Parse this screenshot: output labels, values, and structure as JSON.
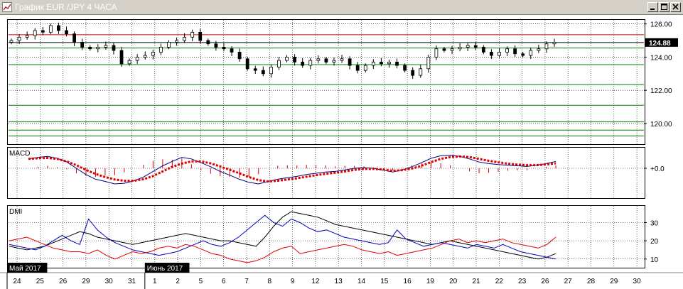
{
  "window": {
    "title": "График EUR /JPY  4 ЧАСА",
    "buttons": [
      "minimize",
      "maximize",
      "close"
    ]
  },
  "colors": {
    "background": "#ffffff",
    "grid": "#000000",
    "red_level": "#c00000",
    "green_level": "#008000",
    "price_badge_bg": "#000000",
    "price_badge_fg": "#ffffff",
    "macd_line": "#000080",
    "signal_line": "#e00000",
    "histogram": "#e00000",
    "dmi_adx": "#000000",
    "dmi_plus": "#0000c0",
    "dmi_minus": "#e00000"
  },
  "chart_data": [
    {
      "type": "candlestick",
      "panel": "price",
      "y_ticks": [
        "126.00",
        "124.00",
        "122.00",
        "120.00"
      ],
      "ylim": [
        118.8,
        126.2
      ],
      "current_price": "124.88",
      "horizontal_levels": [
        {
          "value": 125.35,
          "color": "red"
        },
        {
          "value": 124.88,
          "color": "black"
        },
        {
          "value": 124.55,
          "color": "green"
        },
        {
          "value": 123.55,
          "color": "green"
        },
        {
          "value": 122.35,
          "color": "green"
        },
        {
          "value": 121.1,
          "color": "green"
        },
        {
          "value": 120.1,
          "color": "green"
        },
        {
          "value": 119.6,
          "color": "green"
        },
        {
          "value": 119.25,
          "color": "green"
        }
      ],
      "close_series": [
        125.0,
        125.2,
        125.3,
        125.6,
        125.5,
        125.9,
        125.6,
        125.4,
        124.9,
        124.6,
        124.5,
        124.6,
        124.7,
        124.4,
        123.6,
        123.8,
        124.0,
        124.1,
        124.3,
        124.6,
        124.9,
        125.0,
        125.2,
        125.5,
        125.0,
        124.8,
        124.6,
        124.5,
        124.3,
        123.9,
        123.3,
        123.2,
        123.0,
        123.4,
        123.8,
        124.0,
        123.7,
        123.5,
        123.8,
        123.9,
        123.7,
        123.8,
        123.9,
        123.5,
        123.2,
        123.5,
        123.7,
        123.6,
        123.7,
        123.5,
        123.2,
        122.9,
        123.3,
        124.0,
        124.5,
        124.4,
        124.5,
        124.6,
        124.7,
        124.6,
        124.3,
        124.1,
        124.3,
        124.5,
        124.2,
        124.1,
        124.4,
        124.5,
        124.8,
        124.9
      ]
    },
    {
      "type": "macd",
      "panel": "MACD",
      "label": "MACD",
      "y_tick": "+0.0",
      "macd_series": [
        0.3,
        0.35,
        0.38,
        0.32,
        0.2,
        0.0,
        -0.2,
        -0.35,
        -0.42,
        -0.5,
        -0.48,
        -0.4,
        -0.28,
        -0.1,
        0.08,
        0.22,
        0.35,
        0.3,
        0.18,
        0.05,
        -0.1,
        -0.22,
        -0.35,
        -0.45,
        -0.5,
        -0.42,
        -0.35,
        -0.3,
        -0.26,
        -0.2,
        -0.16,
        -0.12,
        -0.1,
        -0.05,
        0.0,
        0.02,
        0.0,
        -0.06,
        -0.12,
        -0.05,
        0.05,
        0.18,
        0.32,
        0.4,
        0.42,
        0.38,
        0.3,
        0.2,
        0.15,
        0.12,
        0.1,
        0.08,
        0.06,
        0.1,
        0.15,
        0.22
      ],
      "signal_series": [
        0.3,
        0.32,
        0.33,
        0.3,
        0.22,
        0.1,
        -0.05,
        -0.18,
        -0.28,
        -0.36,
        -0.4,
        -0.4,
        -0.35,
        -0.25,
        -0.1,
        0.05,
        0.15,
        0.22,
        0.22,
        0.16,
        0.06,
        -0.05,
        -0.16,
        -0.28,
        -0.38,
        -0.42,
        -0.4,
        -0.36,
        -0.32,
        -0.27,
        -0.22,
        -0.18,
        -0.14,
        -0.1,
        -0.05,
        -0.02,
        -0.02,
        -0.04,
        -0.08,
        -0.06,
        -0.01,
        0.08,
        0.2,
        0.3,
        0.36,
        0.38,
        0.36,
        0.3,
        0.24,
        0.19,
        0.15,
        0.12,
        0.1,
        0.1,
        0.12,
        0.16
      ]
    },
    {
      "type": "line",
      "panel": "DMI",
      "label": "DMI",
      "y_ticks": [
        "30",
        "20",
        "10"
      ],
      "ylim": [
        6,
        38
      ],
      "series": [
        {
          "role": "adx",
          "values": [
            17,
            16,
            15,
            16,
            17,
            19,
            21,
            23,
            25,
            24,
            22,
            21,
            20,
            19,
            18,
            19,
            20,
            21,
            22,
            23,
            24,
            23,
            22,
            21,
            20,
            20,
            19,
            18,
            17,
            22,
            28,
            33,
            36,
            35,
            34,
            33,
            31,
            29,
            28,
            27,
            26,
            25,
            24,
            23,
            22,
            21,
            20,
            19,
            18,
            19,
            20,
            19,
            18,
            17,
            16,
            15,
            14,
            13,
            12,
            11,
            10,
            11,
            13
          ]
        },
        {
          "role": "plus_di",
          "values": [
            18,
            17,
            16,
            15,
            17,
            20,
            23,
            20,
            18,
            32,
            26,
            22,
            19,
            17,
            15,
            14,
            13,
            12,
            13,
            14,
            16,
            18,
            20,
            18,
            17,
            19,
            22,
            26,
            30,
            34,
            30,
            28,
            32,
            30,
            27,
            25,
            26,
            24,
            22,
            21,
            20,
            19,
            18,
            19,
            26,
            21,
            19,
            17,
            18,
            19,
            18,
            17,
            16,
            18,
            17,
            16,
            18,
            16,
            14,
            13,
            12,
            11,
            10
          ]
        },
        {
          "role": "minus_di",
          "values": [
            20,
            21,
            22,
            20,
            18,
            16,
            15,
            14,
            14,
            13,
            15,
            12,
            10,
            12,
            14,
            13,
            14,
            16,
            17,
            16,
            18,
            17,
            15,
            13,
            12,
            10,
            9,
            8,
            9,
            11,
            14,
            16,
            17,
            13,
            14,
            15,
            16,
            17,
            18,
            17,
            15,
            14,
            13,
            14,
            12,
            13,
            14,
            15,
            16,
            18,
            20,
            21,
            19,
            20,
            19,
            20,
            21,
            19,
            18,
            17,
            16,
            18,
            22
          ]
        }
      ]
    }
  ],
  "x_axis": {
    "month_labels": [
      {
        "text": "Май 2017",
        "at": 0
      },
      {
        "text": "Июнь 2017",
        "at": 6
      }
    ],
    "day_labels": [
      "24",
      "25",
      "26",
      "29",
      "30",
      "31",
      "1",
      "2",
      "5",
      "6",
      "7",
      "8",
      "9",
      "12",
      "13",
      "14",
      "15",
      "16",
      "19",
      "20",
      "21",
      "22",
      "23",
      "26",
      "27",
      "28",
      "29",
      "30"
    ]
  }
}
